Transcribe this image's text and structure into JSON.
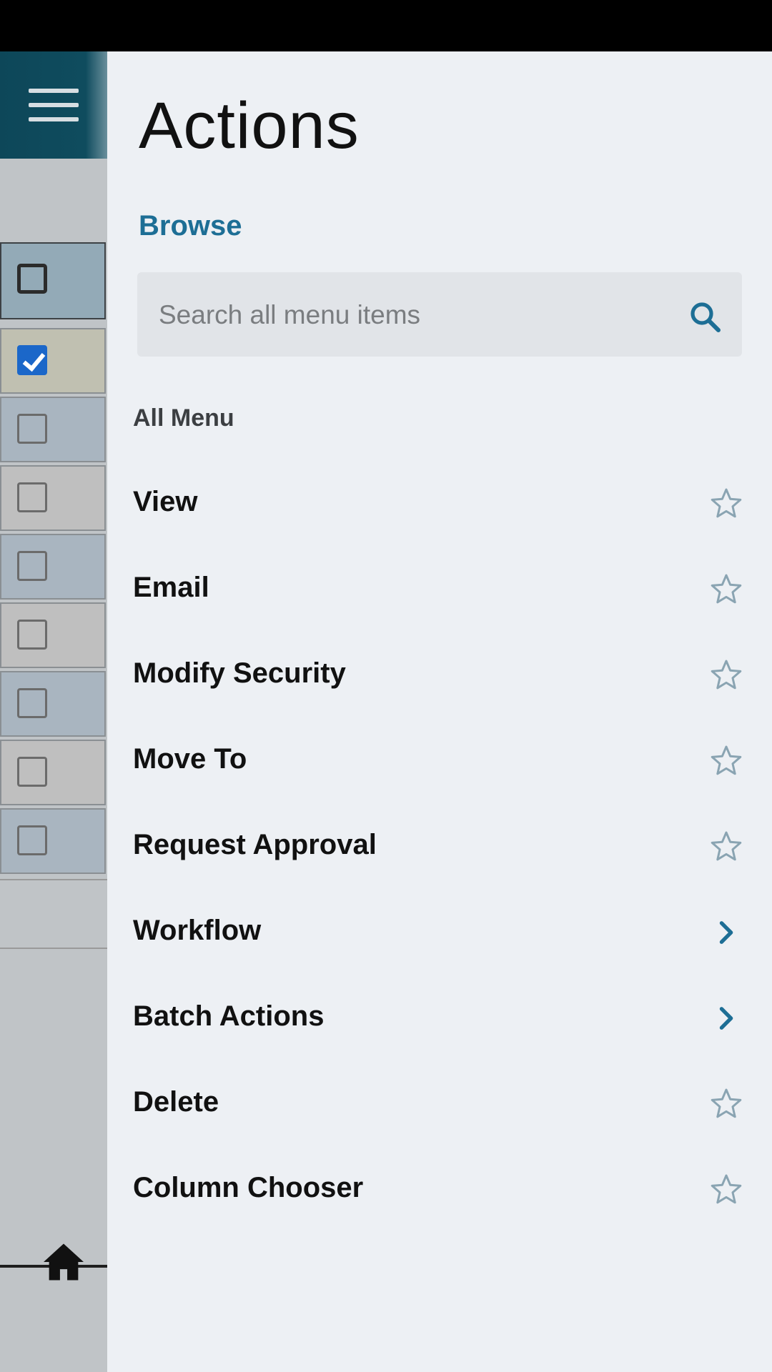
{
  "drawer": {
    "title": "Actions",
    "breadcrumb": "Browse",
    "search": {
      "placeholder": "Search all menu items",
      "value": ""
    },
    "section_label": "All Menu",
    "items": [
      {
        "label": "View",
        "trailing_icon": "star-outline-icon"
      },
      {
        "label": "Email",
        "trailing_icon": "star-outline-icon"
      },
      {
        "label": "Modify Security",
        "trailing_icon": "star-outline-icon"
      },
      {
        "label": "Move To",
        "trailing_icon": "star-outline-icon"
      },
      {
        "label": "Request Approval",
        "trailing_icon": "star-outline-icon"
      },
      {
        "label": "Workflow",
        "trailing_icon": "chevron-right-icon"
      },
      {
        "label": "Batch Actions",
        "trailing_icon": "chevron-right-icon"
      },
      {
        "label": "Delete",
        "trailing_icon": "star-outline-icon"
      },
      {
        "label": "Column Chooser",
        "trailing_icon": "star-outline-icon"
      }
    ]
  },
  "background_list": {
    "select_all_checked": false,
    "rows_checked": [
      true,
      false,
      false,
      false,
      false,
      false,
      false,
      false
    ]
  },
  "icons": {
    "menu": "hamburger-menu-icon",
    "search": "search-icon",
    "home": "home-icon"
  },
  "colors": {
    "header_bg": "#0f4c5e",
    "accent": "#1d6e95",
    "drawer_bg": "#edf0f4",
    "checkbox_checked": "#1b67c9",
    "star": "#8aa4b2"
  }
}
